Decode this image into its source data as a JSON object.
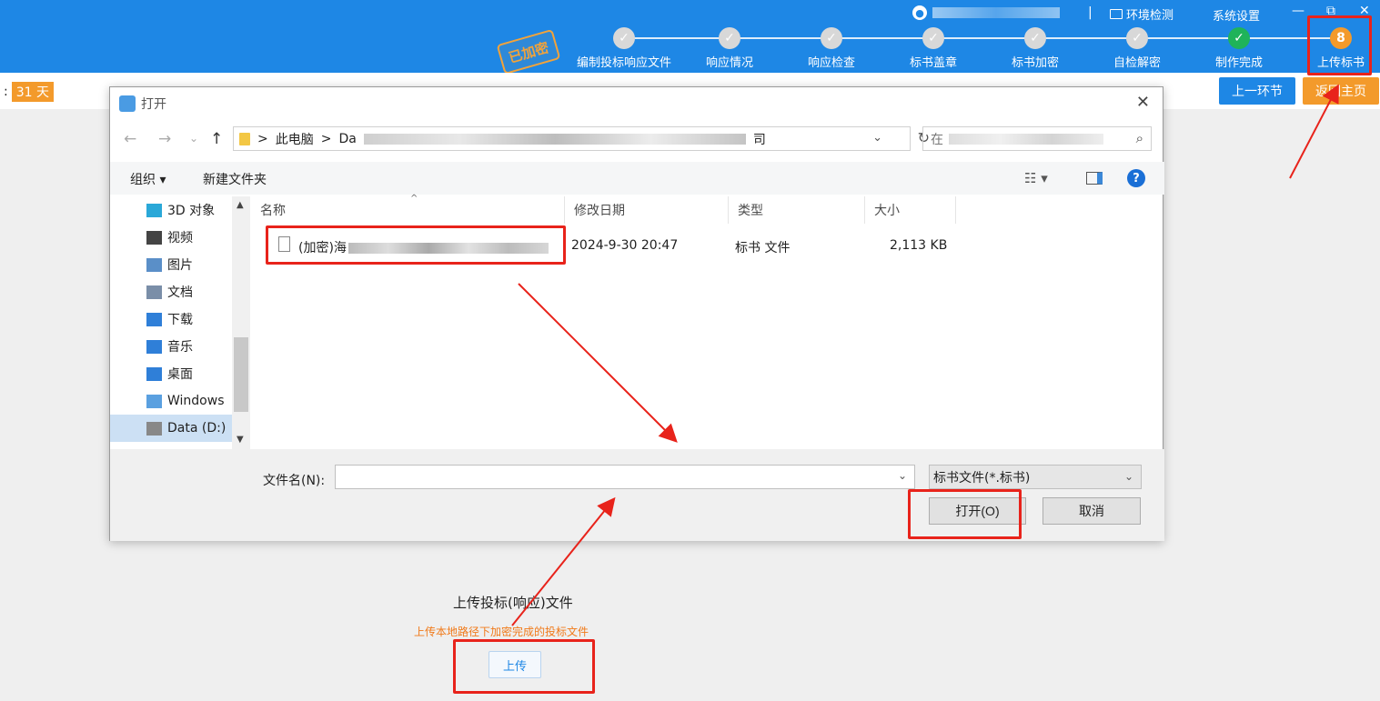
{
  "topbar": {
    "user_separator": "|",
    "env_check": "环境检测",
    "settings": "系统设置",
    "min": "—",
    "restore": "⧉",
    "close": "✕",
    "stamp": "已加密",
    "steps": [
      {
        "label": "编制投标响应文件",
        "state": "done",
        "mark": "✓"
      },
      {
        "label": "响应情况",
        "state": "done",
        "mark": "✓"
      },
      {
        "label": "响应检查",
        "state": "done",
        "mark": "✓"
      },
      {
        "label": "标书盖章",
        "state": "done",
        "mark": "✓"
      },
      {
        "label": "标书加密",
        "state": "done",
        "mark": "✓"
      },
      {
        "label": "自检解密",
        "state": "done",
        "mark": "✓"
      },
      {
        "label": "制作完成",
        "state": "complete",
        "mark": "✓"
      },
      {
        "label": "上传标书",
        "state": "active",
        "mark": "8"
      }
    ]
  },
  "subbar": {
    "colon": ":",
    "days": "31 天",
    "prev_button": "上一环节",
    "home_button": "返回主页"
  },
  "upload": {
    "title": "上传投标(响应)文件",
    "hint": "上传本地路径下加密完成的投标文件",
    "button": "上传"
  },
  "dialog": {
    "title": "打开",
    "close": "✕",
    "back": "←",
    "forward": "→",
    "recent": "⌄",
    "up": "↑",
    "address": {
      "root": "此电脑",
      "sep": ">",
      "drive_prefix": "Da",
      "tail": "司"
    },
    "search_prefix": "在",
    "toolbar": {
      "organize": "组织 ▾",
      "new_folder": "新建文件夹",
      "view": "☷ ▾",
      "help": "?"
    },
    "nav_items": [
      {
        "label": "3D 对象",
        "icon": "3d-objects-icon",
        "color": "#2aa8d8"
      },
      {
        "label": "视频",
        "icon": "video-icon",
        "color": "#444444"
      },
      {
        "label": "图片",
        "icon": "pictures-icon",
        "color": "#5a8fc8"
      },
      {
        "label": "文档",
        "icon": "documents-icon",
        "color": "#7a8ea8"
      },
      {
        "label": "下载",
        "icon": "downloads-icon",
        "color": "#2f7fd8"
      },
      {
        "label": "音乐",
        "icon": "music-icon",
        "color": "#2f7fd8"
      },
      {
        "label": "桌面",
        "icon": "desktop-icon",
        "color": "#2f7fd8"
      },
      {
        "label": "Windows",
        "icon": "windows-drive-icon",
        "color": "#5aa0e0"
      },
      {
        "label": "Data (D:)",
        "icon": "drive-icon",
        "color": "#888888"
      }
    ],
    "columns": {
      "name": "名称",
      "modified": "修改日期",
      "type": "类型",
      "size": "大小"
    },
    "file": {
      "name_prefix": "(加密)海",
      "modified": "2024-9-30 20:47",
      "type": "标书 文件",
      "size": "2,113 KB"
    },
    "filename_label": "文件名(N):",
    "filename_value": "",
    "filetype": "标书文件(*.标书)",
    "open_button": "打开(O)",
    "cancel_button": "取消"
  }
}
